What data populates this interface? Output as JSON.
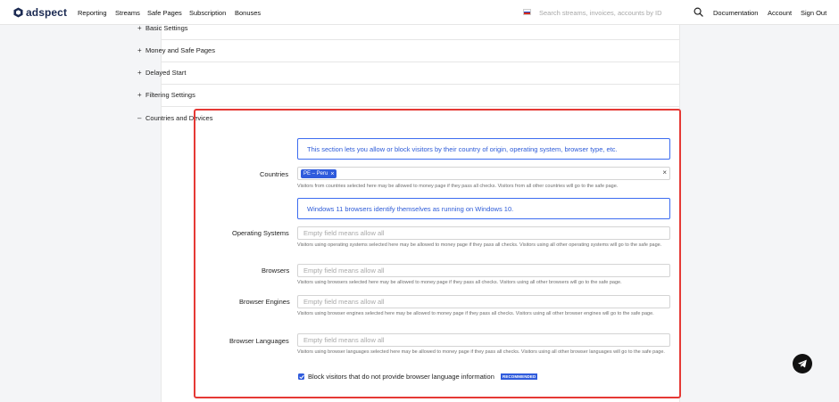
{
  "brand": {
    "name": "adspect",
    "logo_icon": "hexagon-logo-icon"
  },
  "nav": {
    "left": [
      "Reporting",
      "Streams",
      "Safe Pages",
      "Subscription",
      "Bonuses"
    ],
    "right": [
      "Documentation",
      "Account",
      "Sign Out"
    ]
  },
  "search": {
    "placeholder": "Search streams, invoices, accounts by ID",
    "value": ""
  },
  "accordion": [
    {
      "label": "Basic Settings",
      "sign": "+"
    },
    {
      "label": "Money and Safe Pages",
      "sign": "+"
    },
    {
      "label": "Delayed Start",
      "sign": "+"
    },
    {
      "label": "Filtering Settings",
      "sign": "+"
    },
    {
      "label": "Countries and Devices",
      "sign": "–"
    }
  ],
  "section": {
    "intro": "This section lets you allow or block visitors by their country of origin, operating system, browser type, etc.",
    "countries": {
      "label": "Countries",
      "tags": [
        "PE – Peru"
      ],
      "help": "Visitors from countries selected here may be allowed to money page if they pass all checks. Visitors from all other countries will go to the safe page."
    },
    "windows_note": "Windows 11 browsers identify themselves as running on Windows 10.",
    "os": {
      "label": "Operating Systems",
      "placeholder": "Empty field means allow all",
      "help": "Visitors using operating systems selected here may be allowed to money page if they pass all checks. Visitors using all other operating systems will go to the safe page."
    },
    "browsers": {
      "label": "Browsers",
      "placeholder": "Empty field means allow all",
      "help": "Visitors using browsers selected here may be allowed to money page if they pass all checks. Visitors using all other browsers will go to the safe page."
    },
    "engines": {
      "label": "Browser Engines",
      "placeholder": "Empty field means allow all",
      "help": "Visitors using browser engines selected here may be allowed to money page if they pass all checks. Visitors using all other browser engines will go to the safe page."
    },
    "languages": {
      "label": "Browser Languages",
      "placeholder": "Empty field means allow all",
      "help": "Visitors using browser languages selected here may be allowed to money page if they pass all checks. Visitors using all other browser languages will go to the safe page."
    },
    "block_lang": {
      "label": "Block visitors that do not provide browser language information",
      "checked": true,
      "badge": "RECOMMENDED"
    }
  },
  "colors": {
    "accent": "#2f5bdc",
    "highlight": "#e53935",
    "brand_text": "#1b2a52"
  },
  "icons": {
    "search": "search-icon",
    "telegram": "telegram-icon",
    "flag": "russia-flag-icon"
  }
}
